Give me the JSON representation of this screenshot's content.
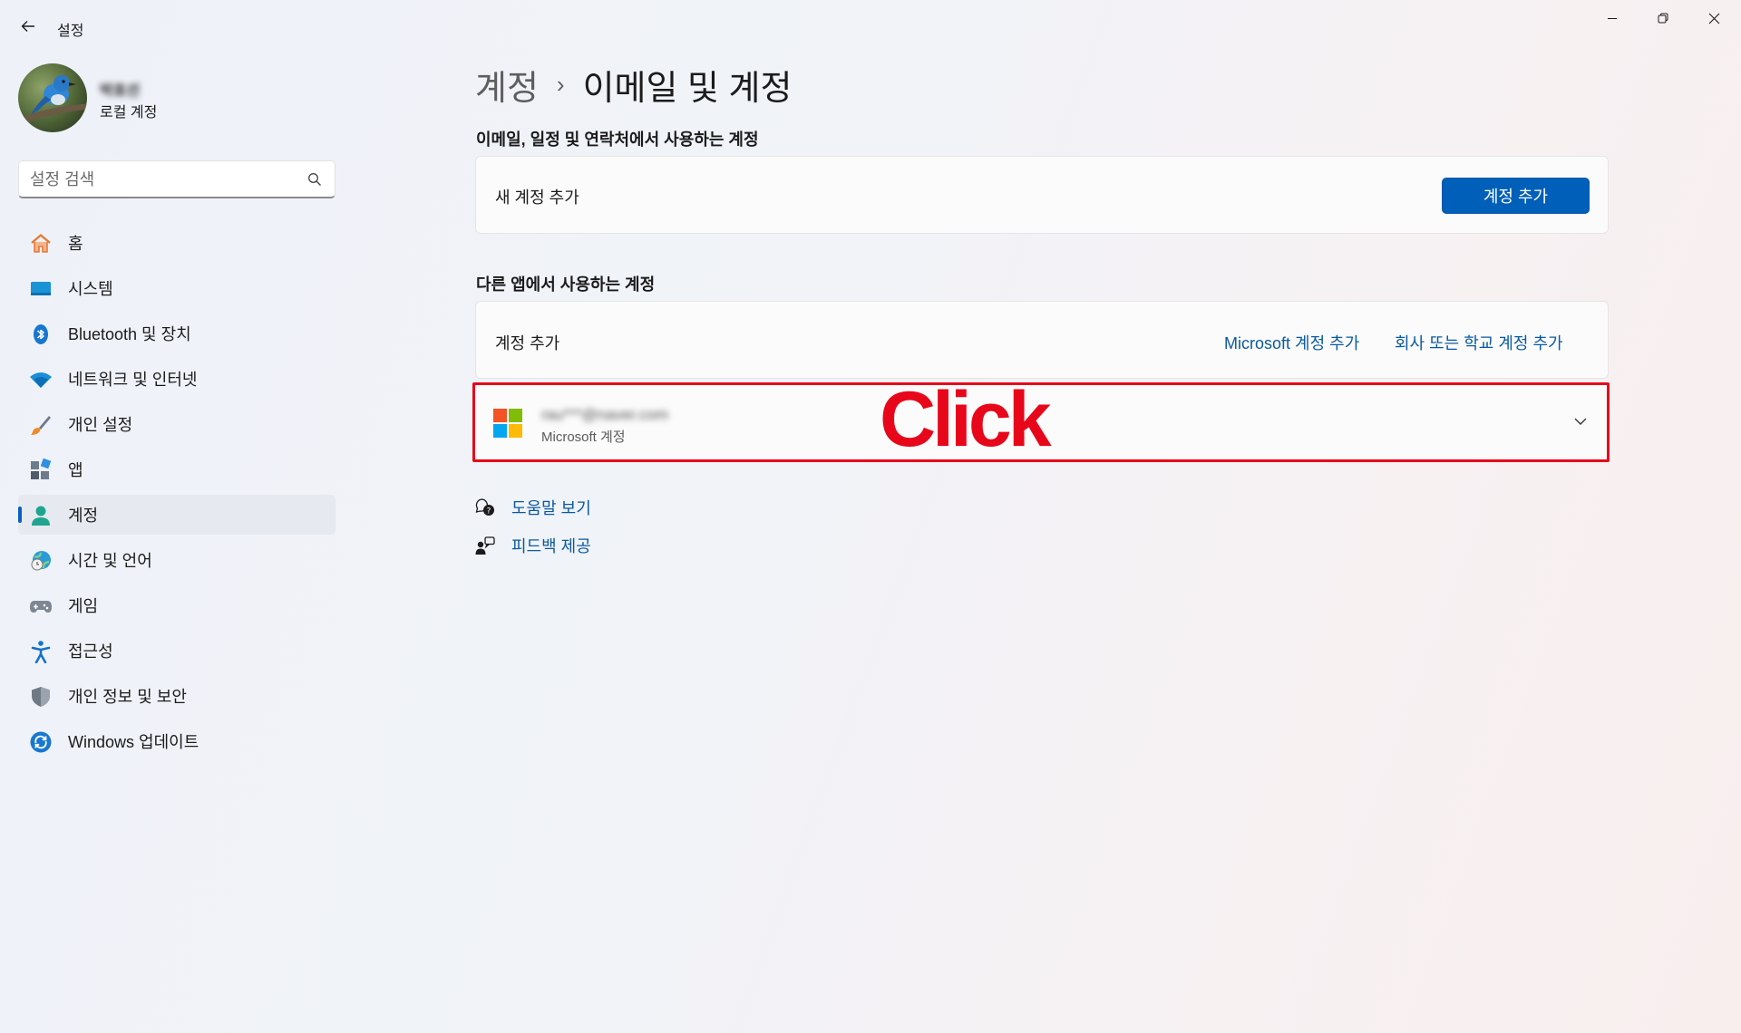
{
  "window": {
    "title": "설정",
    "controls": {
      "minimize": "minimize-icon",
      "maximize": "restore-icon",
      "close": "close-icon"
    }
  },
  "profile": {
    "name": "박효선",
    "account_type": "로컬 계정"
  },
  "search": {
    "placeholder": "설정 검색",
    "value": ""
  },
  "sidebar": {
    "items": [
      {
        "label": "홈",
        "icon": "home-icon"
      },
      {
        "label": "시스템",
        "icon": "system-icon"
      },
      {
        "label": "Bluetooth 및 장치",
        "icon": "bluetooth-icon"
      },
      {
        "label": "네트워크 및 인터넷",
        "icon": "wifi-icon"
      },
      {
        "label": "개인 설정",
        "icon": "brush-icon"
      },
      {
        "label": "앱",
        "icon": "apps-icon"
      },
      {
        "label": "계정",
        "icon": "person-icon",
        "active": true
      },
      {
        "label": "시간 및 언어",
        "icon": "globe-clock-icon"
      },
      {
        "label": "게임",
        "icon": "gamepad-icon"
      },
      {
        "label": "접근성",
        "icon": "accessibility-icon"
      },
      {
        "label": "개인 정보 및 보안",
        "icon": "shield-icon"
      },
      {
        "label": "Windows 업데이트",
        "icon": "update-icon"
      }
    ]
  },
  "main": {
    "breadcrumb": {
      "parent": "계정",
      "separator": "›",
      "current": "이메일 및 계정"
    },
    "section1": {
      "title": "이메일, 일정 및 연락처에서 사용하는 계정",
      "row_label": "새 계정 추가",
      "button_label": "계정 추가"
    },
    "section2": {
      "title": "다른 앱에서 사용하는 계정",
      "row_label": "계정 추가",
      "link_microsoft": "Microsoft 계정 추가",
      "link_work": "회사 또는 학교 계정 추가",
      "account": {
        "email": "rau***@naver.com",
        "type": "Microsoft 계정"
      }
    },
    "annotation": "Click",
    "help": {
      "get_help": "도움말 보기",
      "feedback": "피드백 제공"
    }
  },
  "colors": {
    "accent": "#005fb8",
    "link": "#0a5a9e",
    "highlight": "#e8071a"
  }
}
